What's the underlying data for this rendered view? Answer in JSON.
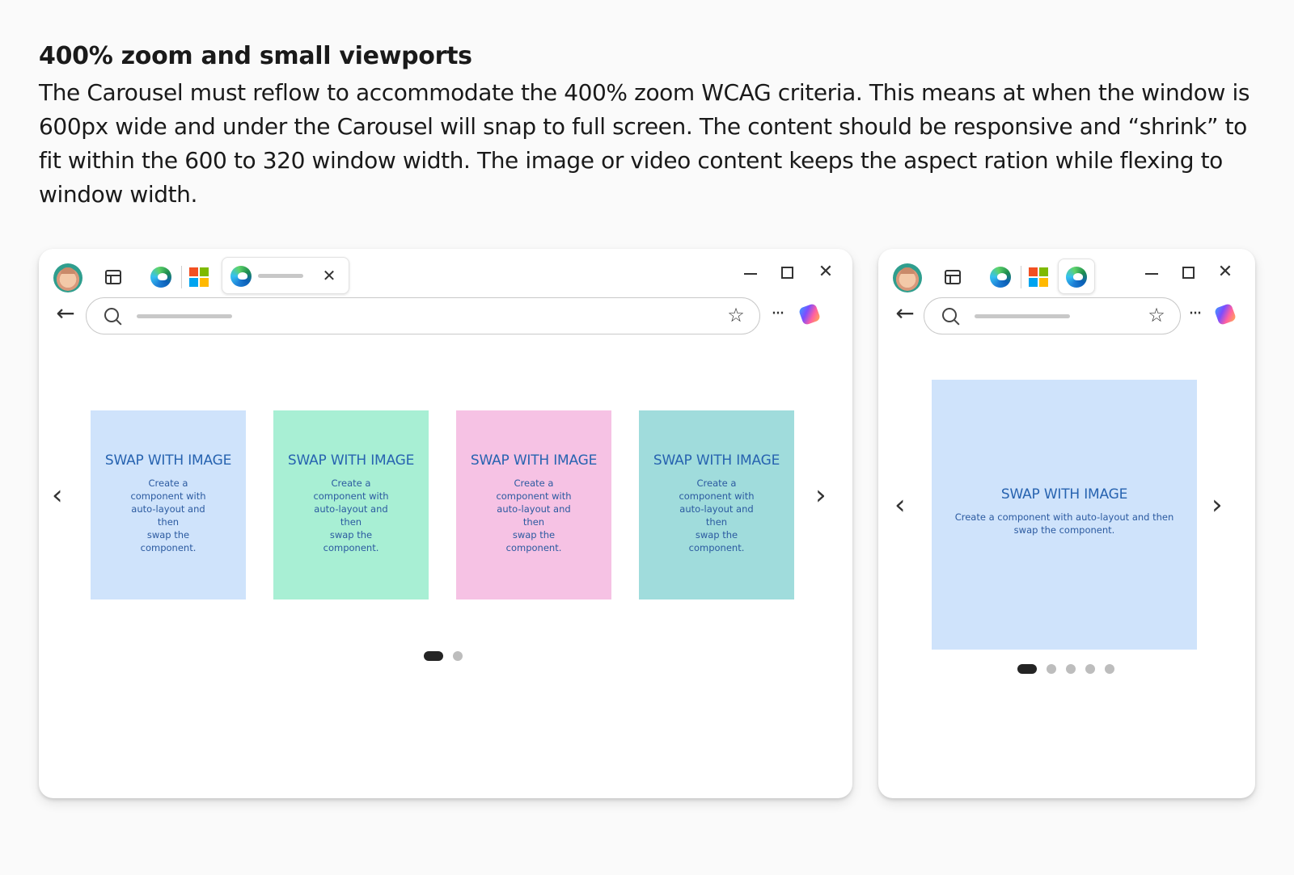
{
  "section": {
    "heading": "400% zoom and small viewports",
    "description": "The Carousel must reflow to accommodate the 400% zoom WCAG criteria. This means at when the window is 600px wide and under the Carousel will snap to full screen. The content should be responsive and “shrink” to fit within the 600 to 320 window width. The image or video content keeps the aspect ration while flexing to window width."
  },
  "browser": {
    "icons": [
      "avatar",
      "tab-actions-icon",
      "edge-icon",
      "microsoft-icon",
      "close-icon",
      "minimize-icon",
      "maximize-icon",
      "back-arrow-icon",
      "search-icon",
      "favorite-add-icon",
      "more-icon",
      "copilot-icon"
    ],
    "colors": {
      "ms_red": "#f25022",
      "ms_green": "#7fba00",
      "ms_blue": "#00a4ef",
      "ms_yellow": "#ffb900"
    }
  },
  "desktop": {
    "cards": [
      {
        "title": "SWAP WITH IMAGE",
        "lines": [
          "Create a",
          "component with",
          "auto-layout and",
          "then",
          "swap the",
          "component."
        ],
        "color": "#cfe3fb"
      },
      {
        "title": "SWAP WITH IMAGE",
        "lines": [
          "Create a",
          "component with",
          "auto-layout and",
          "then",
          "swap the",
          "component."
        ],
        "color": "#a8efd4"
      },
      {
        "title": "SWAP WITH IMAGE",
        "lines": [
          "Create a",
          "component with",
          "auto-layout and",
          "then",
          "swap the",
          "component."
        ],
        "color": "#f6c2e4"
      },
      {
        "title": "SWAP WITH IMAGE",
        "lines": [
          "Create a",
          "component with",
          "auto-layout and",
          "then",
          "swap the",
          "component."
        ],
        "color": "#a0dcdc"
      }
    ],
    "pagination": {
      "count": 2,
      "active": 1
    }
  },
  "mobile": {
    "card": {
      "title": "SWAP WITH IMAGE",
      "lines": [
        "Create a component with auto-layout and then",
        "swap the component."
      ],
      "color": "#cfe3fb"
    },
    "pagination": {
      "count": 5,
      "active": 1
    }
  }
}
